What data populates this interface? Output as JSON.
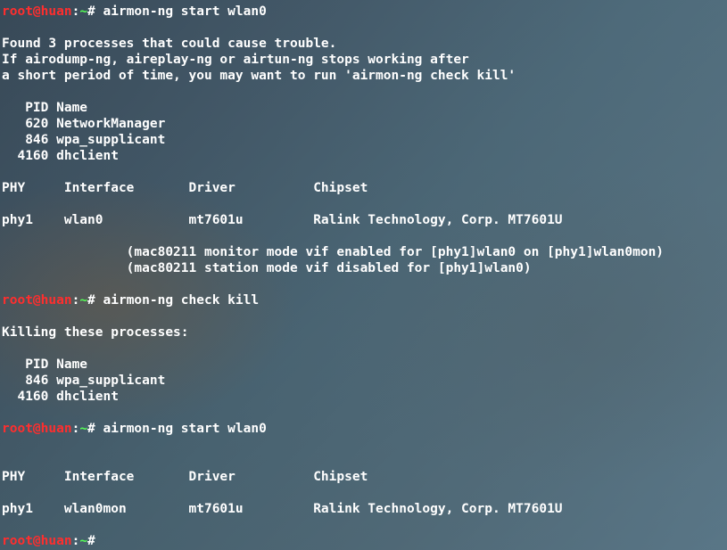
{
  "prompt": {
    "user": "root@huan",
    "colon": ":",
    "tilde": "~",
    "hash": "#"
  },
  "blocks": [
    {
      "cmd": " airmon-ng start wlan0",
      "output": [
        "",
        "Found 3 processes that could cause trouble.",
        "If airodump-ng, aireplay-ng or airtun-ng stops working after",
        "a short period of time, you may want to run 'airmon-ng check kill'",
        "",
        "   PID Name",
        "   620 NetworkManager",
        "   846 wpa_supplicant",
        "  4160 dhclient",
        "",
        "PHY     Interface       Driver          Chipset",
        "",
        "phy1    wlan0           mt7601u         Ralink Technology, Corp. MT7601U",
        "",
        "                (mac80211 monitor mode vif enabled for [phy1]wlan0 on [phy1]wlan0mon)",
        "                (mac80211 station mode vif disabled for [phy1]wlan0)",
        ""
      ]
    },
    {
      "cmd": " airmon-ng check kill",
      "output": [
        "",
        "Killing these processes:",
        "",
        "   PID Name",
        "   846 wpa_supplicant",
        "  4160 dhclient",
        ""
      ]
    },
    {
      "cmd": " airmon-ng start wlan0",
      "output": [
        "",
        "",
        "PHY     Interface       Driver          Chipset",
        "",
        "phy1    wlan0mon        mt7601u         Ralink Technology, Corp. MT7601U",
        ""
      ]
    },
    {
      "cmd": " ",
      "output": []
    }
  ]
}
